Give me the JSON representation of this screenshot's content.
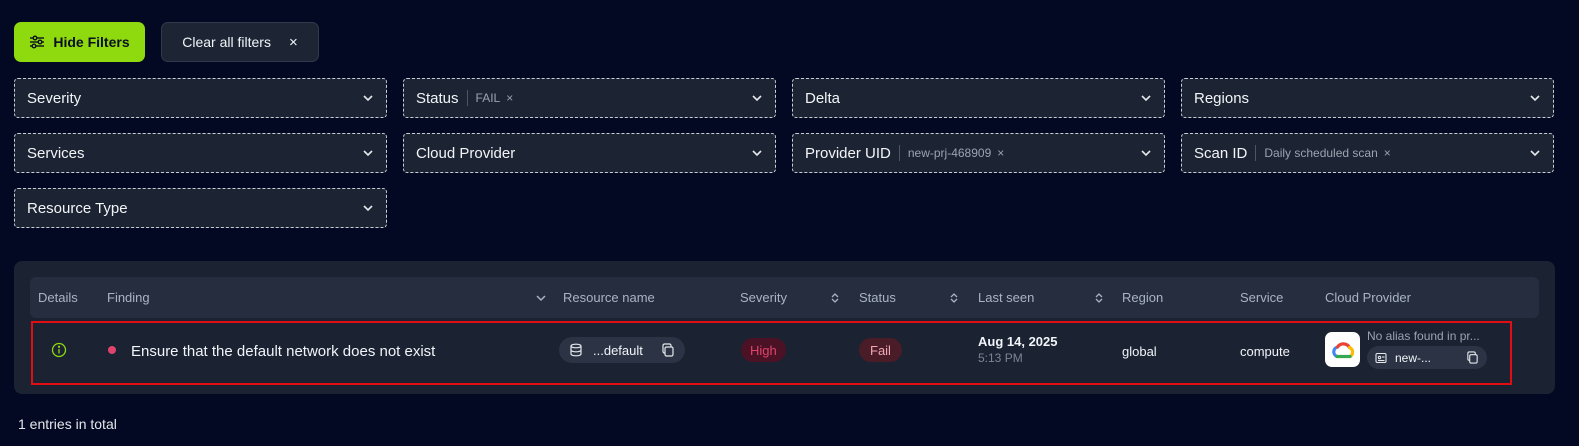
{
  "toolbar": {
    "hide_filters_label": "Hide Filters",
    "clear_filters_label": "Clear all filters",
    "clear_icon": "×"
  },
  "filters": {
    "severity": {
      "label": "Severity"
    },
    "status": {
      "label": "Status",
      "value": "FAIL"
    },
    "delta": {
      "label": "Delta"
    },
    "regions": {
      "label": "Regions"
    },
    "services": {
      "label": "Services"
    },
    "cloud_provider": {
      "label": "Cloud Provider"
    },
    "provider_uid": {
      "label": "Provider UID",
      "value": "new-prj-468909"
    },
    "scan_id": {
      "label": "Scan ID",
      "value": "Daily scheduled scan"
    },
    "resource_type": {
      "label": "Resource Type"
    },
    "remove_icon": "×"
  },
  "table": {
    "columns": {
      "details": "Details",
      "finding": "Finding",
      "resource_name": "Resource name",
      "severity": "Severity",
      "status": "Status",
      "last_seen": "Last seen",
      "region": "Region",
      "service": "Service",
      "cloud_provider": "Cloud Provider"
    },
    "rows": [
      {
        "finding": "Ensure that the default network does not exist",
        "resource_name": "...default",
        "severity": "High",
        "status": "Fail",
        "last_seen_date": "Aug 14, 2025",
        "last_seen_time": "5:13 PM",
        "region": "global",
        "service": "compute",
        "provider_alias": "No alias found in pr...",
        "provider_uid": "new-..."
      }
    ]
  },
  "footer": {
    "total_text": "1 entries in total"
  },
  "colors": {
    "accent": "#8fd90f",
    "background": "#030922",
    "severity_high": "#e0446c",
    "status_fail": "#f0a7b4",
    "highlight_border": "#e00d13"
  },
  "icons": {
    "filter": "sliders-icon",
    "chevron": "chevron-down-icon",
    "details": "info-icon",
    "resource": "database-icon",
    "copy": "copy-icon",
    "provider": "google-cloud-icon"
  }
}
